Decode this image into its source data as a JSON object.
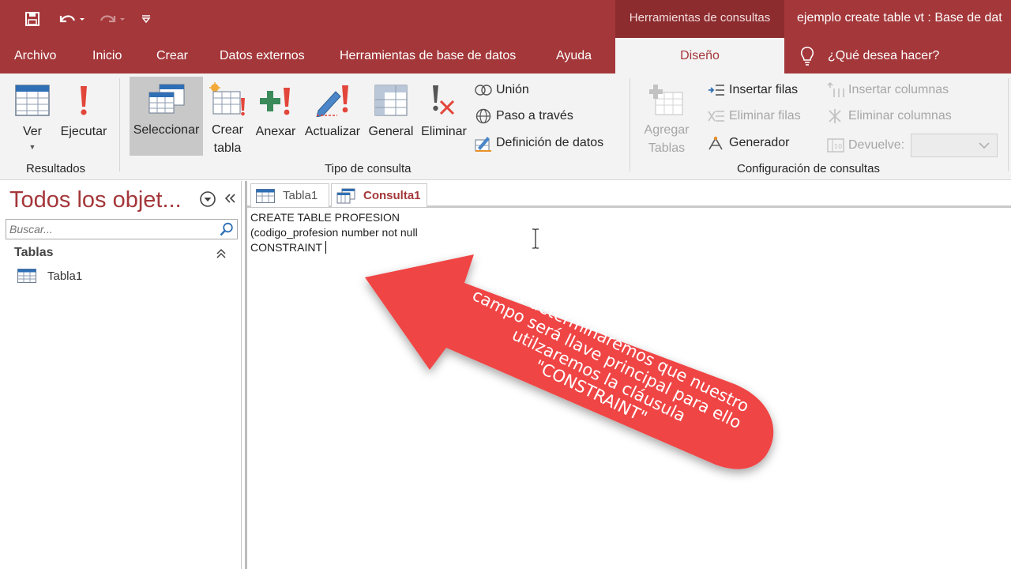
{
  "titlebar": {
    "context_tools": "Herramientas de consultas",
    "document_title": "ejemplo create table vt : Base de dat"
  },
  "menu": {
    "tabs": [
      "Archivo",
      "Inicio",
      "Crear",
      "Datos externos",
      "Herramientas de base de datos",
      "Ayuda"
    ],
    "active_tab": "Diseño",
    "tell_me": "¿Qué desea hacer?"
  },
  "ribbon": {
    "results": {
      "label": "Resultados",
      "ver": "Ver",
      "ejecutar": "Ejecutar"
    },
    "query_type": {
      "label": "Tipo de consulta",
      "seleccionar": "Seleccionar",
      "crear": "Crear",
      "tabla": "tabla",
      "anexar": "Anexar",
      "actualizar": "Actualizar",
      "general": "General",
      "eliminar": "Eliminar",
      "union": "Unión",
      "paso": "Paso a través",
      "definicion": "Definición de datos"
    },
    "query_setup": {
      "label": "Configuración de consultas",
      "agregar": "Agregar",
      "tablas": "Tablas",
      "insertar_filas": "Insertar filas",
      "eliminar_filas": "Eliminar filas",
      "generador": "Generador",
      "insertar_columnas": "Insertar columnas",
      "eliminar_columnas": "Eliminar columnas",
      "devuelve": "Devuelve:",
      "devuelve_value": ""
    }
  },
  "nav": {
    "title": "Todos los objet...",
    "search_placeholder": "Buscar...",
    "group": "Tablas",
    "items": [
      "Tabla1"
    ]
  },
  "tabs": [
    "Tabla1",
    "Consulta1"
  ],
  "sql": {
    "lines": [
      "CREATE TABLE PROFESION",
      "(codigo_profesion number not null",
      "CONSTRAINT "
    ]
  },
  "annotation": {
    "text": "Ahora determinaremos que nuestro campo será llave principal para ello utilzaremos la cláusula \"CONSTRAINT\"",
    "color": "#f04545"
  },
  "colors": {
    "accent": "#a4373a",
    "context_tab": "#8c2c2f",
    "ribbon": "#f3f3f3"
  }
}
